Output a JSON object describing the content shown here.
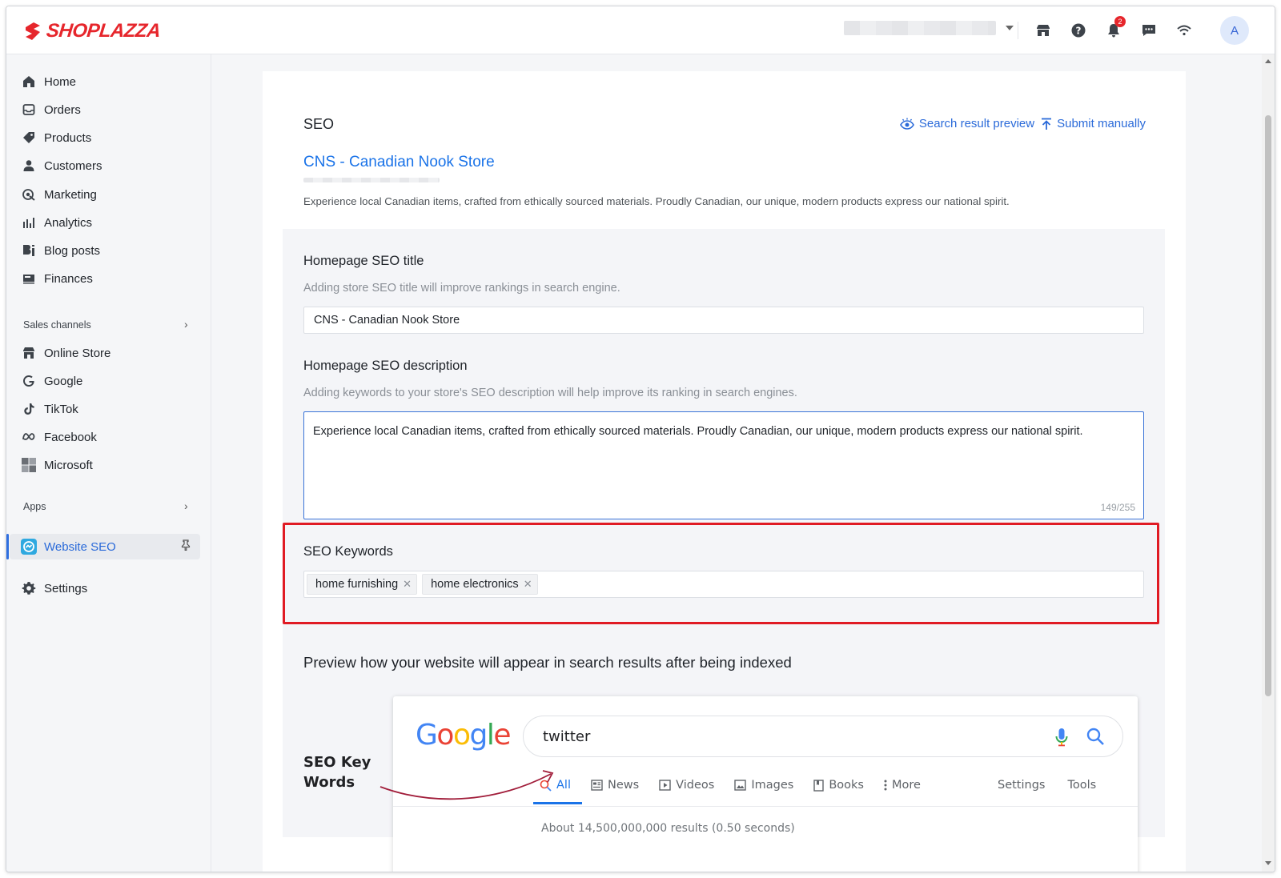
{
  "brand": {
    "name": "SHOPLAZZA",
    "color": "#e6262c"
  },
  "topbar": {
    "icons": [
      "store-icon",
      "help-icon",
      "bell-icon",
      "chat-icon",
      "wifi-icon"
    ],
    "notification_count": "2",
    "avatar_initial": "A"
  },
  "sidebar": {
    "items": [
      {
        "label": "Home",
        "icon": "home-icon"
      },
      {
        "label": "Orders",
        "icon": "orders-icon"
      },
      {
        "label": "Products",
        "icon": "tag-icon"
      },
      {
        "label": "Customers",
        "icon": "user-icon"
      },
      {
        "label": "Marketing",
        "icon": "marketing-icon"
      },
      {
        "label": "Analytics",
        "icon": "bar-chart-icon"
      },
      {
        "label": "Blog posts",
        "icon": "blog-icon"
      },
      {
        "label": "Finances",
        "icon": "finances-icon"
      }
    ],
    "sales_channels_label": "Sales channels",
    "channels": [
      {
        "label": "Online Store",
        "icon": "store-icon"
      },
      {
        "label": "Google",
        "icon": "google-icon"
      },
      {
        "label": "TikTok",
        "icon": "tiktok-icon"
      },
      {
        "label": "Facebook",
        "icon": "meta-icon"
      },
      {
        "label": "Microsoft",
        "icon": "microsoft-icon"
      }
    ],
    "apps_label": "Apps",
    "active_app": {
      "label": "Website SEO",
      "icon": "website-seo-icon"
    },
    "settings_label": "Settings"
  },
  "main": {
    "heading": "SEO",
    "links": {
      "search_preview": "Search result preview",
      "submit_manually": "Submit manually"
    },
    "preview": {
      "title": "CNS - Canadian Nook Store",
      "description": "Experience local Canadian items, crafted from ethically sourced materials. Proudly Canadian, our unique, modern products express our national spirit."
    },
    "seo_title": {
      "label": "Homepage SEO title",
      "hint": "Adding store SEO title will improve rankings in search engine.",
      "value": "CNS - Canadian Nook Store"
    },
    "seo_description": {
      "label": "Homepage SEO description",
      "hint": "Adding keywords to your store's SEO description will help improve its ranking in search engines.",
      "value": "Experience local Canadian items, crafted from ethically sourced materials. Proudly Canadian, our unique, modern products express our national spirit.",
      "counter": "149/255"
    },
    "seo_keywords": {
      "label": "SEO Keywords",
      "tags": [
        "home furnishing",
        "home electronics"
      ],
      "highlight_color": "#e01b24"
    },
    "preview_heading": "Preview how your website will appear in search results after being indexed",
    "annotation": "SEO Key Words"
  },
  "google_mock": {
    "logo": [
      "G",
      "o",
      "o",
      "g",
      "l",
      "e"
    ],
    "logo_colors": [
      "#4285f4",
      "#ea4335",
      "#fbbc05",
      "#4285f4",
      "#34a853",
      "#ea4335"
    ],
    "query": "twitter",
    "tabs": [
      "All",
      "News",
      "Videos",
      "Images",
      "Books",
      "More"
    ],
    "tools": [
      "Settings",
      "Tools"
    ],
    "results_count": "About 14,500,000,000 results (0.50 seconds)"
  }
}
